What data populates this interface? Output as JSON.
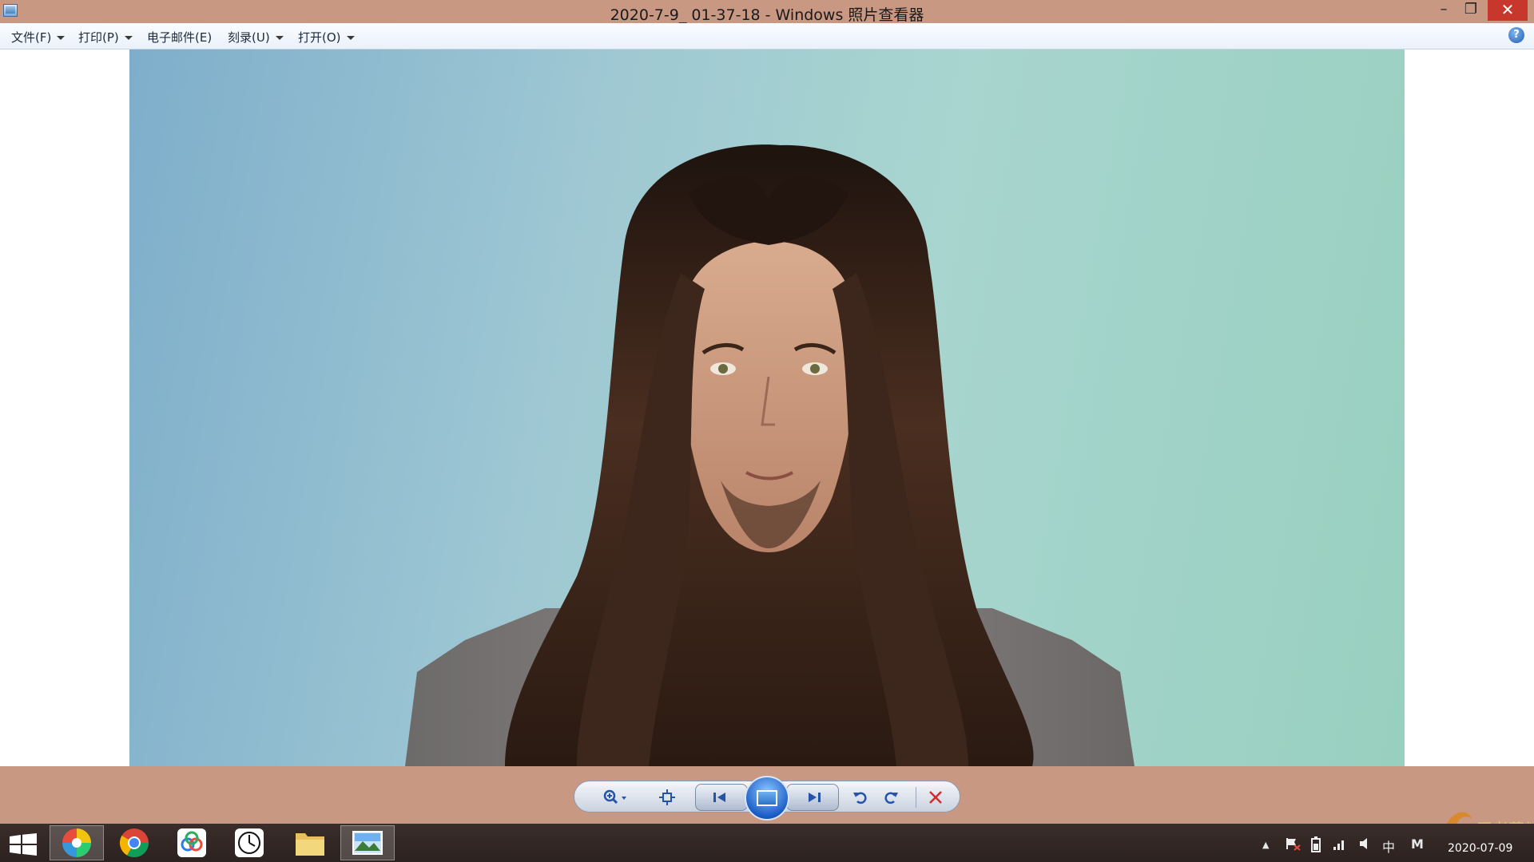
{
  "window": {
    "title": "2020-7-9_ 01-37-18 - Windows 照片查看器",
    "controls": {
      "minimize": "–",
      "maximize": "❐",
      "close": "✕"
    }
  },
  "menu": {
    "file": "文件(F)",
    "print": "打印(P)",
    "email": "电子邮件(E)",
    "burn": "刻录(U)",
    "open": "打开(O)",
    "help": "?"
  },
  "toolbar": {
    "zoom_icon": "zoom-icon",
    "actual_size_icon": "fit-icon",
    "previous_icon": "previous-icon",
    "slideshow_icon": "slideshow-icon",
    "next_icon": "next-icon",
    "rotate_ccw_icon": "rotate-ccw-icon",
    "rotate_cw_icon": "rotate-cw-icon",
    "delete_icon": "delete-icon"
  },
  "taskbar": {
    "apps": [
      "start",
      "color-wheel-app",
      "chrome",
      "baidu-netdisk",
      "clock-app",
      "file-explorer",
      "photo-viewer"
    ],
    "tray": {
      "show_hidden": "▲",
      "ime": "中",
      "m": "M"
    },
    "clock_date": "2020-07-09"
  },
  "watermark": {
    "text": "王者荣耀"
  },
  "colors": {
    "titlebar": "#c99882",
    "taskbar": "#2c2220",
    "accent_blue": "#2453a8",
    "close_red": "#c7372b"
  }
}
